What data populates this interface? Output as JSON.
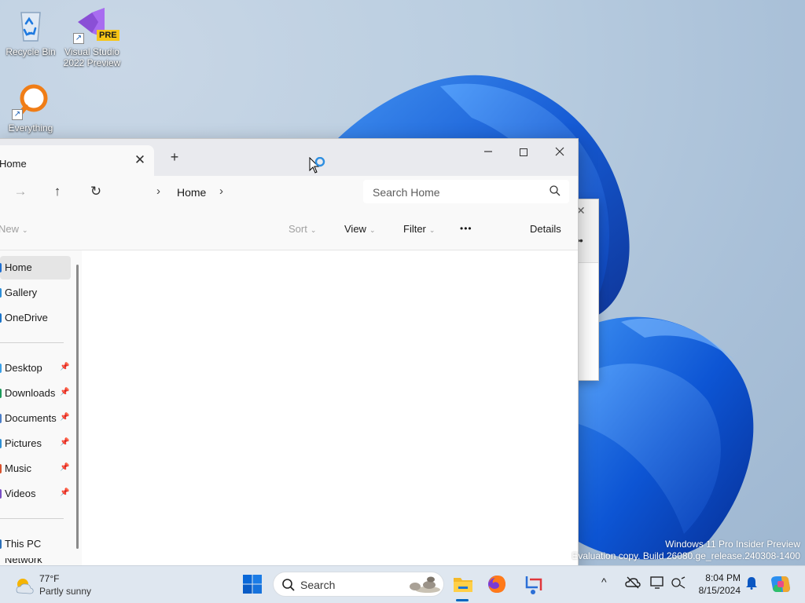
{
  "desktop": {
    "icons": [
      {
        "label": "Recycle Bin"
      },
      {
        "label": "Visual Studio 2022 Preview",
        "badge": "PRE"
      },
      {
        "label": "Everything"
      }
    ],
    "watermark": {
      "line1": "Windows 11 Pro Insider Preview",
      "line2": "Evaluation copy. Build 26080.ge_release.240308-1400"
    }
  },
  "explorer": {
    "tab_title": "Home",
    "tab_close_glyph": "✕",
    "new_tab_glyph": "+",
    "address": {
      "chevron_left": "›",
      "crumb": "Home",
      "chevron_right": "›"
    },
    "search_placeholder": "Search Home",
    "commands": {
      "new_label": "New",
      "sort_label": "Sort",
      "view_label": "View",
      "filter_label": "Filter",
      "more_label": "•••",
      "details_label": "Details"
    },
    "sidebar": [
      {
        "label": "Home",
        "selected": true
      },
      {
        "label": "Gallery"
      },
      {
        "label": "OneDrive"
      },
      {
        "label": "Desktop",
        "pinned": true
      },
      {
        "label": "Downloads",
        "pinned": true
      },
      {
        "label": "Documents",
        "pinned": true
      },
      {
        "label": "Pictures",
        "pinned": true
      },
      {
        "label": "Music",
        "pinned": true
      },
      {
        "label": "Videos",
        "pinned": true
      },
      {
        "label": "This PC"
      },
      {
        "label": "Network"
      }
    ]
  },
  "taskbar": {
    "weather_temp": "77°F",
    "weather_desc": "Partly sunny",
    "search_label": "Search",
    "time": "8:04 PM",
    "date": "8/15/2024",
    "tray_chevron": "^"
  },
  "colors": {
    "accent": "#0067c0",
    "windows_blue": "#0a5fd8"
  }
}
